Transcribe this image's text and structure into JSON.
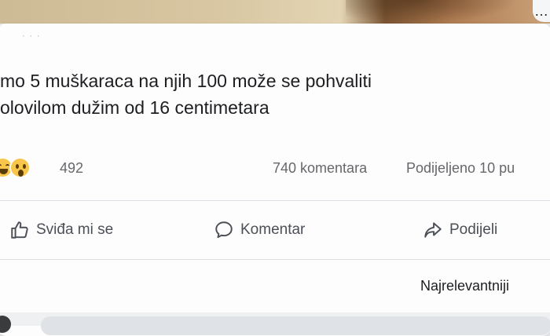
{
  "post": {
    "author_name_faint": "· · ·",
    "text_lines": [
      "mo 5 muškaraca na njih 100 može se pohvaliti",
      "olovilom dužim od 16 centimetara"
    ]
  },
  "stats": {
    "reactions": [
      "laughing-emoji",
      "surprised-emoji"
    ],
    "reaction_count": "492",
    "comments": "740 komentara",
    "shares": "Podijeljeno 10 pu"
  },
  "actions": {
    "like_label": "Sviđa mi se",
    "comment_label": "Komentar",
    "share_label": "Podijeli"
  },
  "comments_section": {
    "sort_label": "Najrelevantniji"
  }
}
